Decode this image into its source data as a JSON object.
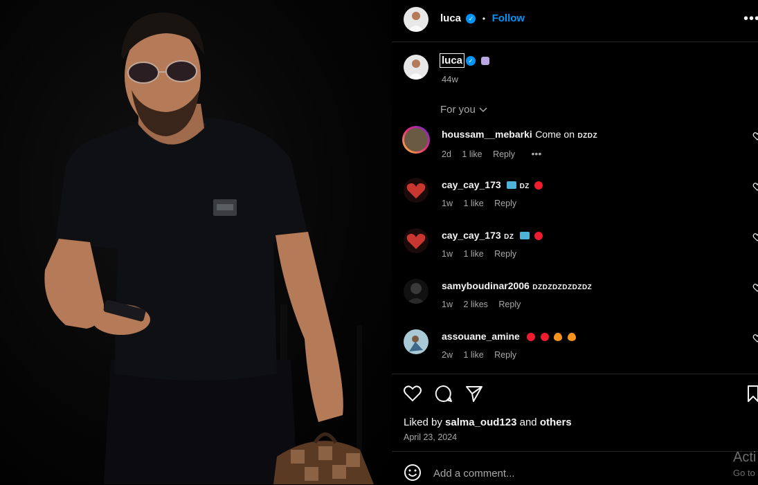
{
  "header": {
    "username": "luca",
    "separator": "•",
    "follow_label": "Follow"
  },
  "caption": {
    "username": "luca",
    "age": "44w",
    "sort_label": "For you"
  },
  "comments": [
    {
      "username": "houssam__mebarki",
      "text": "Come on",
      "badge": "DZDZ",
      "age": "2d",
      "likes": "1 like",
      "reply": "Reply"
    },
    {
      "username": "cay_cay_173",
      "text": "",
      "badge": "DZ",
      "age": "1w",
      "likes": "1 like",
      "reply": "Reply"
    },
    {
      "username": "cay_cay_173",
      "text": "",
      "badge": "DZ",
      "age": "1w",
      "likes": "1 like",
      "reply": "Reply"
    },
    {
      "username": "samyboudinar2006",
      "text": "",
      "badge": "DZDZDZDZDZDZ",
      "age": "1w",
      "likes": "2 likes",
      "reply": "Reply"
    },
    {
      "username": "assouane_amine",
      "text": "",
      "badge": "",
      "age": "2w",
      "likes": "1 like",
      "reply": "Reply"
    }
  ],
  "likes": {
    "prefix": "Liked by",
    "user": "salma_oud123",
    "and": "and",
    "others": "others",
    "date": "April 23, 2024"
  },
  "add_comment": {
    "placeholder": "Add a comment..."
  },
  "watermark": {
    "line1": "Acti",
    "line2": "Go to"
  },
  "colors": {
    "accent": "#0095f6",
    "heart": "#ed1c2f",
    "background": "#000000"
  },
  "icons": [
    "more-icon",
    "verified-icon",
    "chevron-down-icon",
    "heart-icon",
    "comment-icon",
    "share-icon",
    "bookmark-icon",
    "emoji-icon"
  ]
}
